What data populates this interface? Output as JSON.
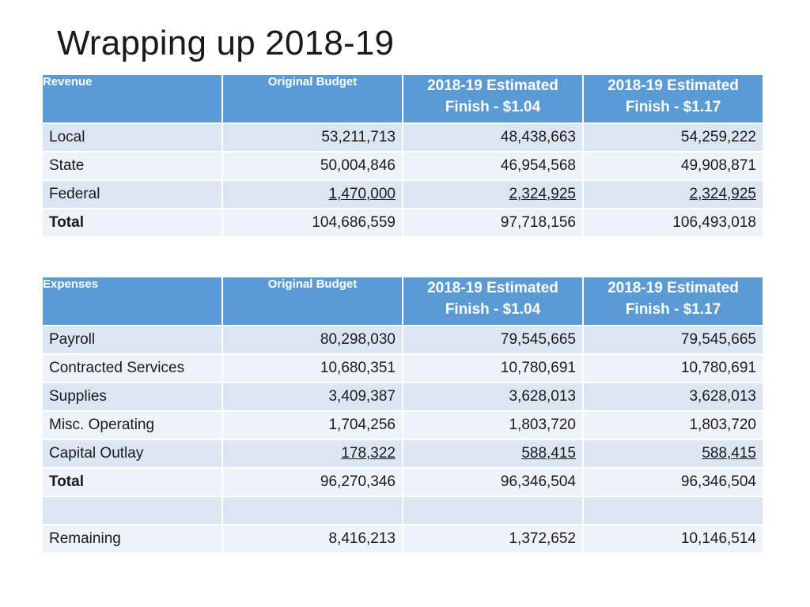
{
  "title": "Wrapping up 2018-19",
  "revenue": {
    "headers": [
      "Revenue",
      "Original Budget",
      "2018-19 Estimated Finish - $1.04",
      "2018-19 Estimated Finish - $1.17"
    ],
    "rows": [
      {
        "label": "Local",
        "original": "53,211,713",
        "est104": "48,438,663",
        "est117": "54,259,222"
      },
      {
        "label": "State",
        "original": "50,004,846",
        "est104": "46,954,568",
        "est117": "49,908,871"
      },
      {
        "label": "Federal",
        "original": "1,470,000",
        "est104": "2,324,925",
        "est117": "2,324,925"
      },
      {
        "label": "Total",
        "original": "104,686,559",
        "est104": "97,718,156",
        "est117": "106,493,018"
      }
    ]
  },
  "expenses": {
    "headers": [
      "Expenses",
      "Original Budget",
      "2018-19 Estimated Finish - $1.04",
      "2018-19 Estimated Finish - $1.17"
    ],
    "rows": [
      {
        "label": "Payroll",
        "original": "80,298,030",
        "est104": "79,545,665",
        "est117": "79,545,665"
      },
      {
        "label": "Contracted Services",
        "original": "10,680,351",
        "est104": "10,780,691",
        "est117": "10,780,691"
      },
      {
        "label": "Supplies",
        "original": "3,409,387",
        "est104": "3,628,013",
        "est117": "3,628,013"
      },
      {
        "label": "Misc. Operating",
        "original": "1,704,256",
        "est104": "1,803,720",
        "est117": "1,803,720"
      },
      {
        "label": "Capital Outlay",
        "original": "178,322",
        "est104": "588,415",
        "est117": "588,415"
      },
      {
        "label": "Total",
        "original": "96,270,346",
        "est104": "96,346,504",
        "est117": "96,346,504"
      }
    ],
    "remaining": {
      "label": "Remaining",
      "original": "8,416,213",
      "est104": "1,372,652",
      "est117": "10,146,514"
    }
  }
}
